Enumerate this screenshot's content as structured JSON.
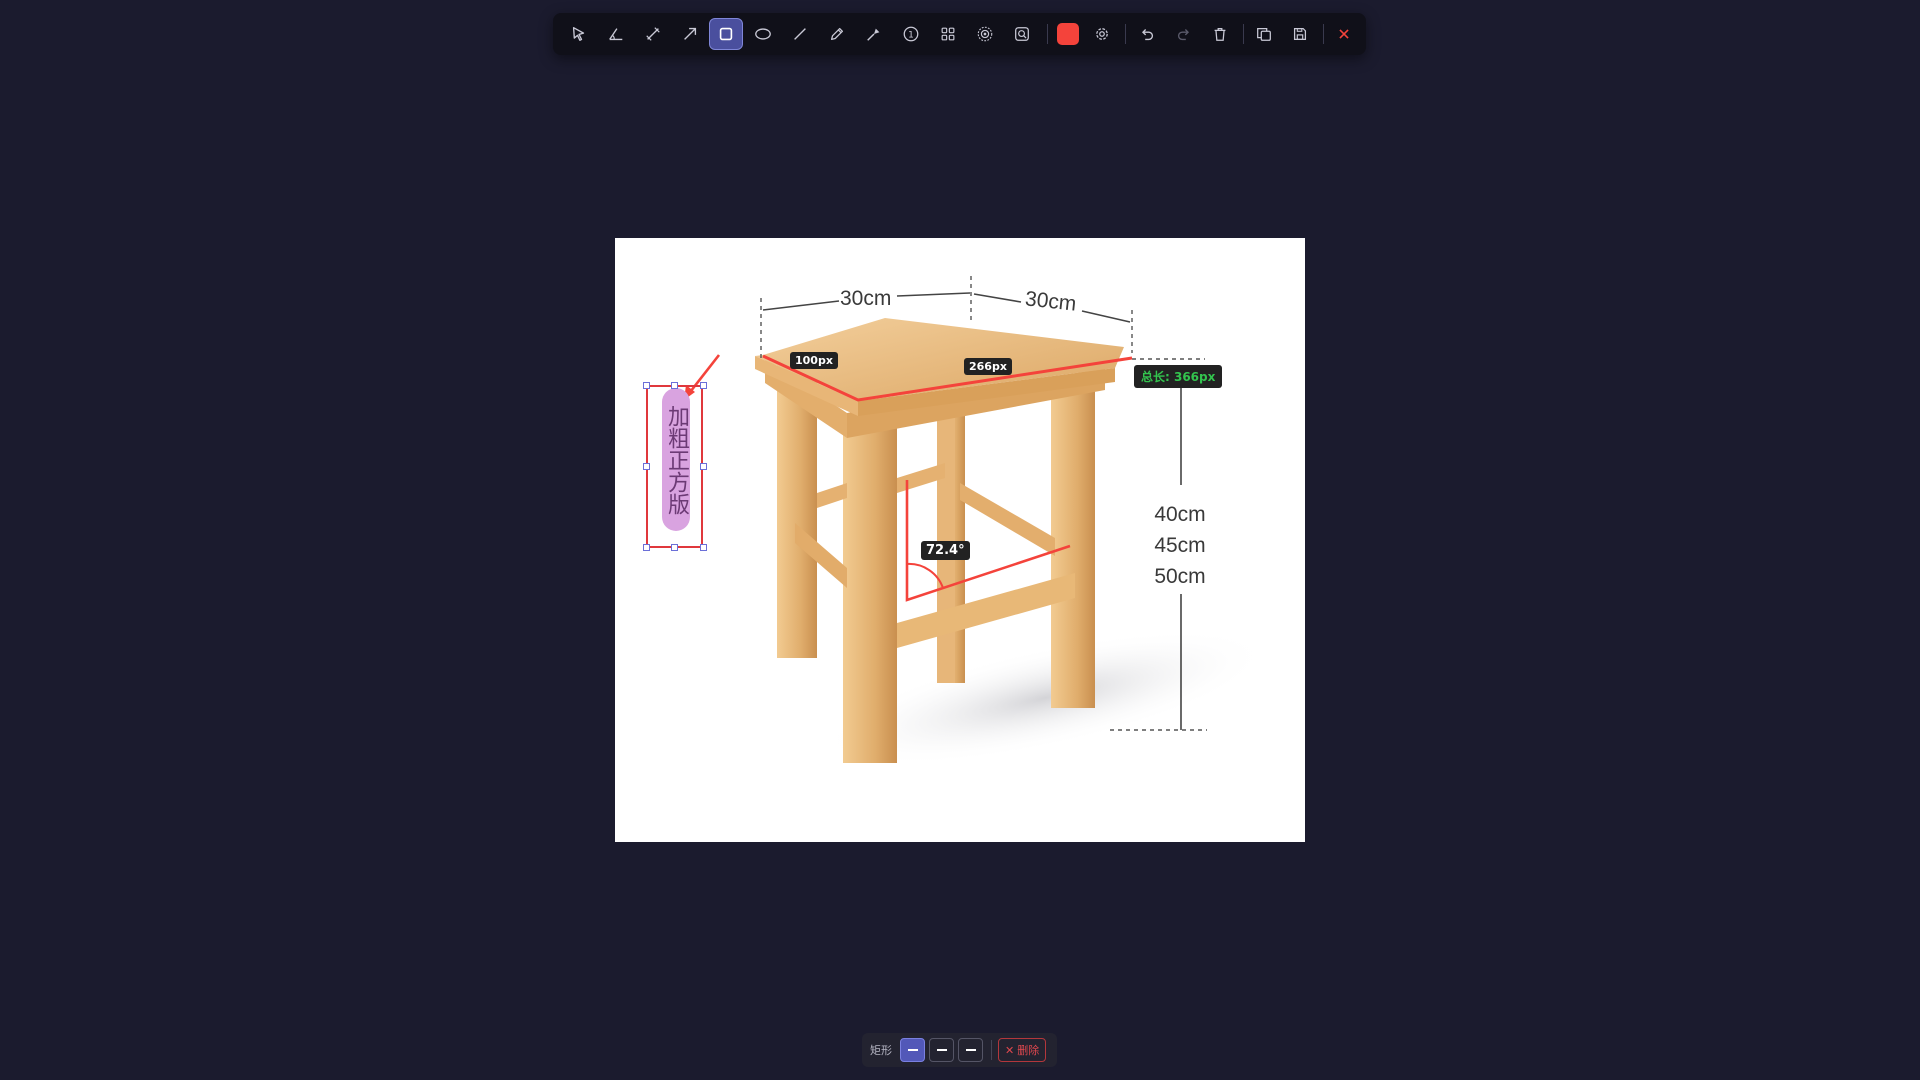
{
  "toolbar": {
    "tools": [
      {
        "name": "select-tool",
        "icon": "cursor-icon"
      },
      {
        "name": "angle-tool",
        "icon": "angle-icon"
      },
      {
        "name": "measure-tool",
        "icon": "ruler-diagonal-icon"
      },
      {
        "name": "arrow-tool",
        "icon": "arrow-icon"
      },
      {
        "name": "rectangle-tool",
        "icon": "square-icon",
        "active": true
      },
      {
        "name": "ellipse-tool",
        "icon": "ellipse-icon"
      },
      {
        "name": "line-tool",
        "icon": "line-icon"
      },
      {
        "name": "pen-tool",
        "icon": "pencil-icon"
      },
      {
        "name": "marker-tool",
        "icon": "marker-icon"
      },
      {
        "name": "number-tool",
        "icon": "numbered-circle-icon",
        "glyph": "1"
      },
      {
        "name": "mosaic-tool",
        "icon": "grid-icon"
      },
      {
        "name": "blur-tool",
        "icon": "blur-icon"
      },
      {
        "name": "magnify-tool",
        "icon": "magnifier-icon"
      }
    ],
    "color": "#f4433b",
    "actions": [
      "settings",
      "undo",
      "redo",
      "delete",
      "copy",
      "save",
      "close"
    ]
  },
  "annotation": {
    "width_left": "30cm",
    "width_right": "30cm",
    "heights": [
      "40cm",
      "45cm",
      "50cm"
    ],
    "segment_1": "100px",
    "segment_2": "266px",
    "total_length": "总长: 366px",
    "angle": "72.4°",
    "label_text": "加粗正方版"
  },
  "bottom_bar": {
    "shape_label": "矩形",
    "delete_label": "删除",
    "delete_icon": "✕"
  },
  "colors": {
    "accent": "#4a4f9e",
    "annotation_red": "#f4433b",
    "total_green": "#33c44e",
    "highlight_purple": "#d9a3e0"
  }
}
